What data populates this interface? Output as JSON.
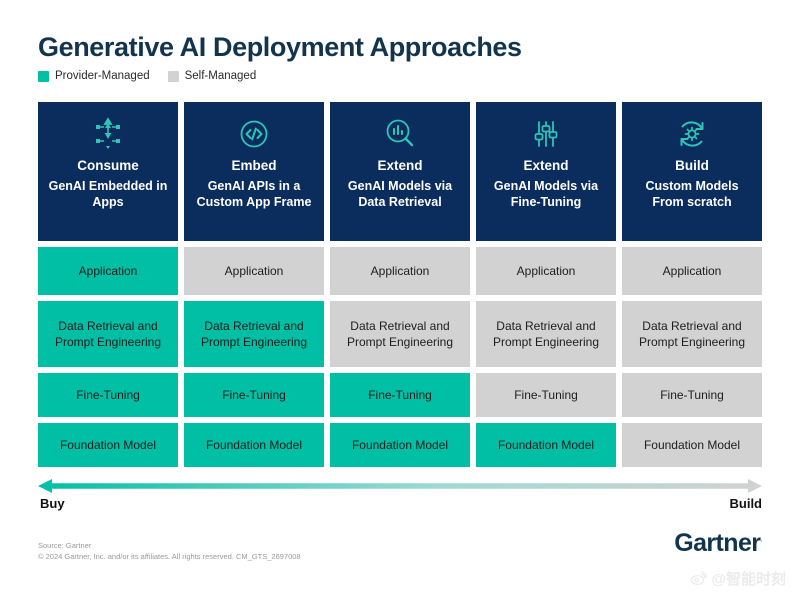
{
  "title": "Generative AI Deployment Approaches",
  "legend": {
    "items": [
      {
        "label": "Provider-Managed",
        "color": "#00bfa5",
        "icon": "legend-swatch-teal"
      },
      {
        "label": "Self-Managed",
        "color": "#d2d2d2",
        "icon": "legend-swatch-gray"
      }
    ]
  },
  "layer_names": [
    "Application",
    "Data Retrieval and Prompt Engineering",
    "Fine-Tuning",
    "Foundation Model"
  ],
  "columns": [
    {
      "icon": "network-nodes-lightning-icon",
      "title": "Consume",
      "subtitle": "GenAI Embedded in Apps",
      "layers": [
        {
          "label": "Application",
          "state": "provider"
        },
        {
          "label": "Data Retrieval and Prompt Engineering",
          "state": "provider"
        },
        {
          "label": "Fine-Tuning",
          "state": "provider"
        },
        {
          "label": "Foundation Model",
          "state": "provider"
        }
      ]
    },
    {
      "icon": "code-brackets-circle-icon",
      "title": "Embed",
      "subtitle": "GenAI APIs in a Custom App Frame",
      "layers": [
        {
          "label": "Application",
          "state": "self"
        },
        {
          "label": "Data Retrieval and Prompt Engineering",
          "state": "provider"
        },
        {
          "label": "Fine-Tuning",
          "state": "provider"
        },
        {
          "label": "Foundation Model",
          "state": "provider"
        }
      ]
    },
    {
      "icon": "magnifier-bar-chart-icon",
      "title": "Extend",
      "subtitle": "GenAI Models via Data Retrieval",
      "layers": [
        {
          "label": "Application",
          "state": "self"
        },
        {
          "label": "Data Retrieval and Prompt Engineering",
          "state": "self"
        },
        {
          "label": "Fine-Tuning",
          "state": "provider"
        },
        {
          "label": "Foundation Model",
          "state": "provider"
        }
      ]
    },
    {
      "icon": "sliders-faders-icon",
      "title": "Extend",
      "subtitle": "GenAI Models via Fine-Tuning",
      "layers": [
        {
          "label": "Application",
          "state": "self"
        },
        {
          "label": "Data Retrieval and Prompt Engineering",
          "state": "self"
        },
        {
          "label": "Fine-Tuning",
          "state": "self"
        },
        {
          "label": "Foundation Model",
          "state": "provider"
        }
      ]
    },
    {
      "icon": "gear-refresh-icon",
      "title": "Build",
      "subtitle": "Custom Models From scratch",
      "layers": [
        {
          "label": "Application",
          "state": "self"
        },
        {
          "label": "Data Retrieval and Prompt Engineering",
          "state": "self"
        },
        {
          "label": "Fine-Tuning",
          "state": "self"
        },
        {
          "label": "Foundation Model",
          "state": "self"
        }
      ]
    }
  ],
  "axis": {
    "left_label": "Buy",
    "right_label": "Build",
    "gradient_from": "#00bfa5",
    "gradient_to": "#d2d2d2"
  },
  "footer": {
    "source": "Source: Gartner",
    "copyright": "© 2024 Gartner, Inc. and/or its affiliates. All rights reserved. CM_GTS_2697008",
    "logo_text": "Gartner",
    "logo_mark": "."
  },
  "watermark": {
    "icon": "weibo-icon",
    "text": "@智能时刻"
  },
  "colors": {
    "header_navy": "#0a2d5e",
    "title_navy": "#12344d",
    "teal": "#00bfa5",
    "gray": "#d2d2d2",
    "icon_teal": "#2ec4b6"
  }
}
